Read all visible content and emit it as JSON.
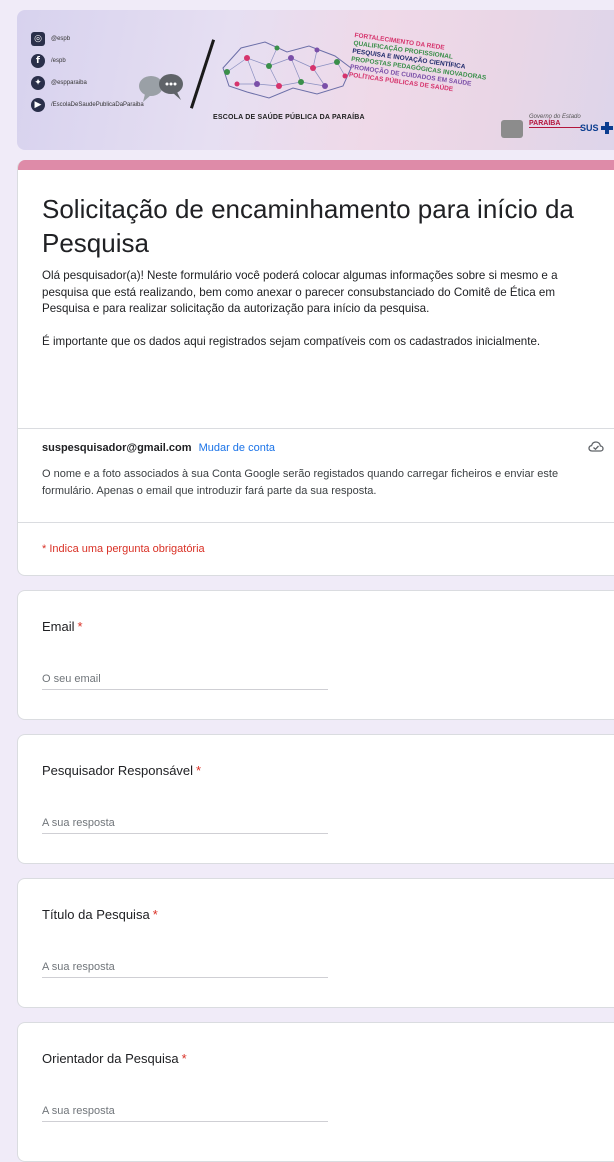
{
  "banner": {
    "social": [
      {
        "icon": "instagram-icon",
        "glyph": "◎",
        "handle": "@espb"
      },
      {
        "icon": "facebook-icon",
        "glyph": "f",
        "handle": "/espb"
      },
      {
        "icon": "twitter-icon",
        "glyph": "✦",
        "handle": "@espparaiba"
      },
      {
        "icon": "youtube-icon",
        "glyph": "▶",
        "handle": "/EscolaDeSaudePublicaDaParaiba"
      }
    ],
    "school_name": "ESCOLA DE SAÚDE PÚBLICA DA PARAÍBA",
    "pillars": [
      {
        "text": "FORTALECIMENTO DA REDE",
        "color": "#d6336c"
      },
      {
        "text": "QUALIFICAÇÃO PROFISSIONAL",
        "color": "#3a8f4a"
      },
      {
        "text": "PESQUISA E INOVAÇÃO CIENTÍFICA",
        "color": "#1f2a6b"
      },
      {
        "text": "PROPOSTAS PEDAGÓGICAS INOVADORAS",
        "color": "#3a8f4a"
      },
      {
        "text": "PROMOÇÃO DE CUIDADOS EM SAÚDE",
        "color": "#7a4fa8"
      },
      {
        "text": "POLÍTICAS PÚBLICAS DE SAÚDE",
        "color": "#d6336c"
      }
    ],
    "gov_text": "Governo do Estado",
    "state_name": "PARAÍBA",
    "sus_text": "SUS"
  },
  "form": {
    "title": "Solicitação de encaminhamento para início da Pesquisa",
    "description_1": "Olá pesquisador(a)! Neste formulário você poderá colocar algumas informações sobre si mesmo e a pesquisa que está realizando, bem como anexar o parecer consubstanciado do Comitê de Ética em Pesquisa e para realizar solicitação da autorização para início da pesquisa.",
    "description_2": "É importante que os dados aqui registrados sejam compatíveis com os cadastrados inicialmente.",
    "account_email": "suspesquisador@gmail.com",
    "switch_account": "Mudar de conta",
    "account_note": "O nome e a foto associados à sua Conta Google serão registados quando carregar ficheiros e enviar este formulário. Apenas o email que introduzir fará parte da sua resposta.",
    "required_note": "* Indica uma pergunta obrigatória"
  },
  "questions": [
    {
      "label": "Email",
      "required": "*",
      "placeholder": "O seu email"
    },
    {
      "label": "Pesquisador Responsável",
      "required": "*",
      "placeholder": "A sua resposta"
    },
    {
      "label": "Título da Pesquisa",
      "required": "*",
      "placeholder": "A sua resposta"
    },
    {
      "label": "Orientador da Pesquisa",
      "required": "*",
      "placeholder": "A sua resposta"
    }
  ],
  "colors": {
    "background": "#f0ebf8",
    "accent_bar": "#de8ba8",
    "required": "#d93025",
    "link": "#1a73e8"
  }
}
